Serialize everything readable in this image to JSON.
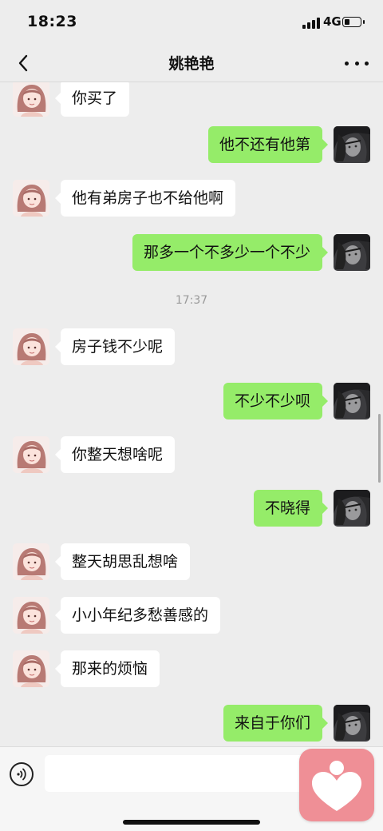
{
  "status_bar": {
    "time": "18:23",
    "network": "4G",
    "battery_level": 0.35
  },
  "nav": {
    "title": "姚艳艳",
    "back_icon": "chevron-left-icon",
    "more_icon": "more-dots-icon"
  },
  "colors": {
    "background": "#ededed",
    "outgoing_bubble": "#95ec69",
    "incoming_bubble": "#ffffff",
    "widget": "#ef8f96"
  },
  "messages": [
    {
      "type": "in",
      "text": "你买了"
    },
    {
      "type": "out",
      "text": "他不还有他第"
    },
    {
      "type": "in",
      "text": "他有弟房子也不给他啊"
    },
    {
      "type": "out",
      "text": "那多一个不多少一个不少"
    },
    {
      "type": "time",
      "text": "17:37"
    },
    {
      "type": "in",
      "text": "房子钱不少呢"
    },
    {
      "type": "out",
      "text": "不少不少呗"
    },
    {
      "type": "in",
      "text": "你整天想啥呢"
    },
    {
      "type": "out",
      "text": "不晓得"
    },
    {
      "type": "in",
      "text": "整天胡思乱想啥"
    },
    {
      "type": "in",
      "text": "小小年纪多愁善感的"
    },
    {
      "type": "in",
      "text": "那来的烦恼"
    },
    {
      "type": "out",
      "text": "来自于你们"
    }
  ],
  "input_bar": {
    "voice_icon": "voice-icon",
    "text": ""
  },
  "overlay": {
    "icon": "heart-person-icon"
  }
}
